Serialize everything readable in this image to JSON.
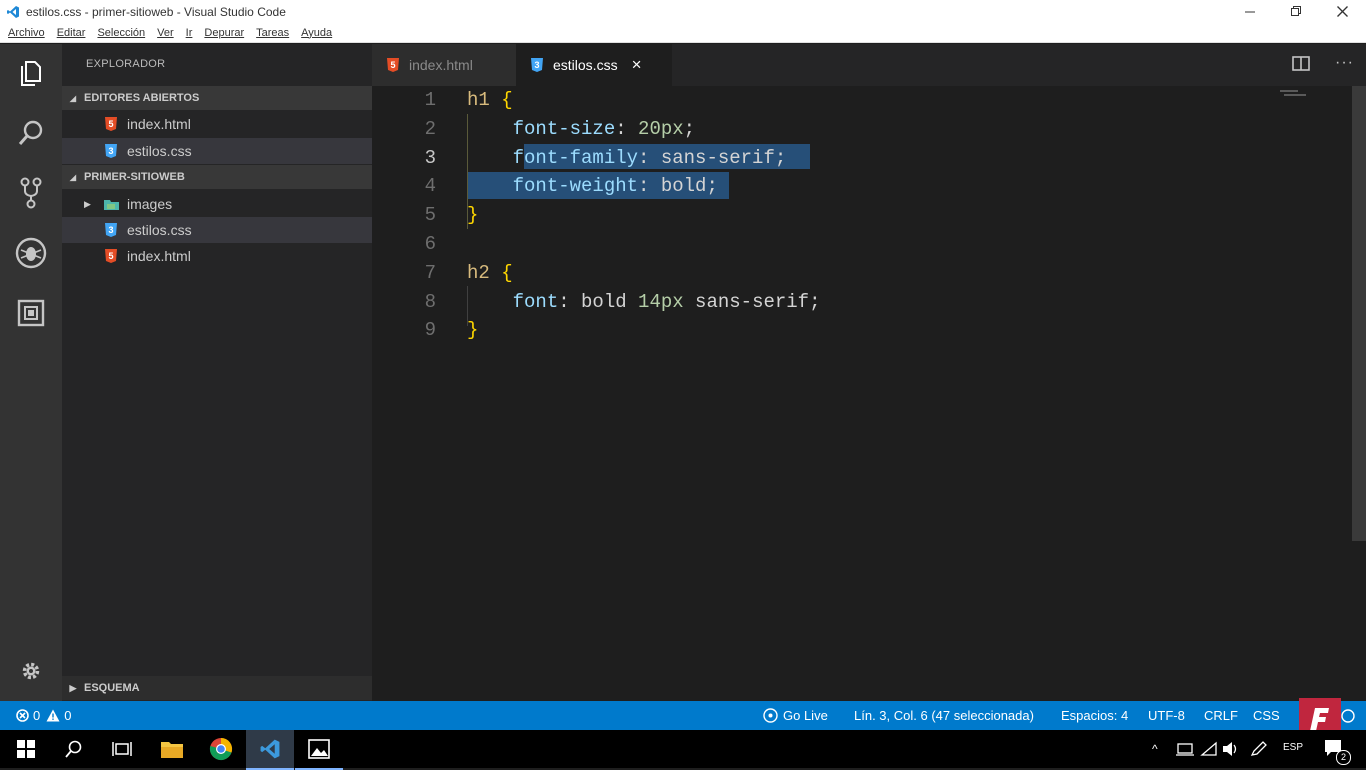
{
  "window": {
    "title": "estilos.css - primer-sitioweb - Visual Studio Code"
  },
  "menu": [
    "Archivo",
    "Editar",
    "Selección",
    "Ver",
    "Ir",
    "Depurar",
    "Tareas",
    "Ayuda"
  ],
  "activity": [
    "explorer-icon",
    "search-icon",
    "source-control-icon",
    "debug-icon",
    "extensions-icon",
    "gear-icon"
  ],
  "sidebar": {
    "title": "EXPLORADOR",
    "open_editors": {
      "label": "EDITORES ABIERTOS",
      "items": [
        {
          "name": "index.html",
          "type": "html"
        },
        {
          "name": "estilos.css",
          "type": "css"
        }
      ]
    },
    "project": {
      "label": "PRIMER-SITIOWEB",
      "items": [
        {
          "name": "images",
          "type": "folder"
        },
        {
          "name": "estilos.css",
          "type": "css"
        },
        {
          "name": "index.html",
          "type": "html"
        }
      ]
    },
    "outline": {
      "label": "ESQUEMA"
    }
  },
  "tabs": [
    {
      "label": "index.html",
      "type": "html",
      "active": false
    },
    {
      "label": "estilos.css",
      "type": "css",
      "active": true,
      "close": "×"
    }
  ],
  "editor": {
    "lines": [
      {
        "n": "1",
        "text": "h1 {"
      },
      {
        "n": "2",
        "text": "    font-size: 20px;"
      },
      {
        "n": "3",
        "text": "    font-family: sans-serif;"
      },
      {
        "n": "4",
        "text": "    font-weight: bold;"
      },
      {
        "n": "5",
        "text": "}"
      },
      {
        "n": "6",
        "text": ""
      },
      {
        "n": "7",
        "text": "h2 {"
      },
      {
        "n": "8",
        "text": "    font: bold 14px sans-serif;"
      },
      {
        "n": "9",
        "text": "}"
      }
    ]
  },
  "status": {
    "errors": "0",
    "warnings": "0",
    "go_live": "Go Live",
    "position": "Lín. 3, Col. 6 (47 seleccionada)",
    "spaces": "Espacios: 4",
    "encoding": "UTF-8",
    "eol": "CRLF",
    "language": "CSS"
  },
  "taskbar": {
    "lang": "ESP",
    "notification_count": "2"
  },
  "colors": {
    "accent": "#007acc",
    "html_icon": "#e44d26",
    "css_icon": "#42a5f5",
    "selection": "#264f78"
  }
}
